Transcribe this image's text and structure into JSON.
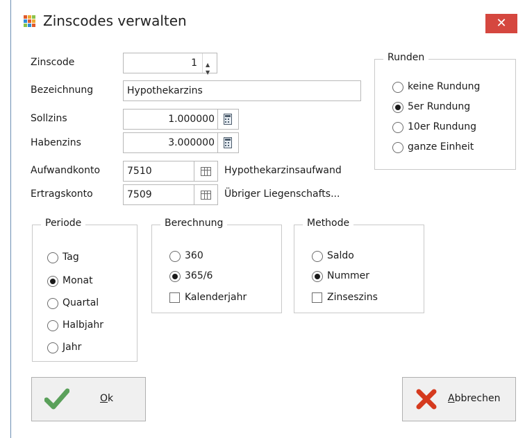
{
  "window": {
    "title": "Zinscodes verwalten",
    "close_label": "✕"
  },
  "fields": {
    "zinscode": {
      "label": "Zinscode",
      "value": "1"
    },
    "bezeichnung": {
      "label": "Bezeichnung",
      "value": "Hypothekarzins"
    },
    "sollzins": {
      "label": "Sollzins",
      "value": "1.000000"
    },
    "habenzins": {
      "label": "Habenzins",
      "value": "3.000000"
    },
    "aufwandkonto": {
      "label": "Aufwandkonto",
      "value": "7510",
      "description": "Hypothekarzinsaufwand"
    },
    "ertragskonto": {
      "label": "Ertragskonto",
      "value": "7509",
      "description": "Übriger Liegenschafts..."
    }
  },
  "runden": {
    "title": "Runden",
    "options": [
      {
        "label": "keine Rundung",
        "selected": false
      },
      {
        "label": "5er Rundung",
        "selected": true
      },
      {
        "label": "10er Rundung",
        "selected": false
      },
      {
        "label": "ganze Einheit",
        "selected": false
      }
    ]
  },
  "periode": {
    "title": "Periode",
    "options": [
      {
        "label": "Tag",
        "selected": false
      },
      {
        "label": "Monat",
        "selected": true
      },
      {
        "label": "Quartal",
        "selected": false
      },
      {
        "label": "Halbjahr",
        "selected": false
      },
      {
        "label": "Jahr",
        "selected": false
      }
    ]
  },
  "berechnung": {
    "title": "Berechnung",
    "options": [
      {
        "label": "360",
        "selected": false
      },
      {
        "label": "365/6",
        "selected": true
      }
    ],
    "checkbox": {
      "label": "Kalenderjahr",
      "checked": false
    }
  },
  "methode": {
    "title": "Methode",
    "options": [
      {
        "label": "Saldo",
        "selected": false
      },
      {
        "label": "Nummer",
        "selected": true
      }
    ],
    "checkbox": {
      "label": "Zinseszins",
      "checked": false
    }
  },
  "buttons": {
    "ok": {
      "label_first": "O",
      "label_rest": "k"
    },
    "cancel": {
      "label_first": "A",
      "label_rest": "bbrechen"
    }
  },
  "icons": {
    "app": "grid-app-icon",
    "close": "close-icon",
    "spin": "spin-icon",
    "calculator": "calculator-icon",
    "lookup": "table-lookup-icon",
    "ok": "checkmark-icon",
    "cancel": "cross-icon"
  },
  "colors": {
    "close_bg": "#d5473f",
    "ok_check": "#5aa05a",
    "cancel_x": "#d53a1e",
    "accent_border": "#6d8fb3"
  }
}
